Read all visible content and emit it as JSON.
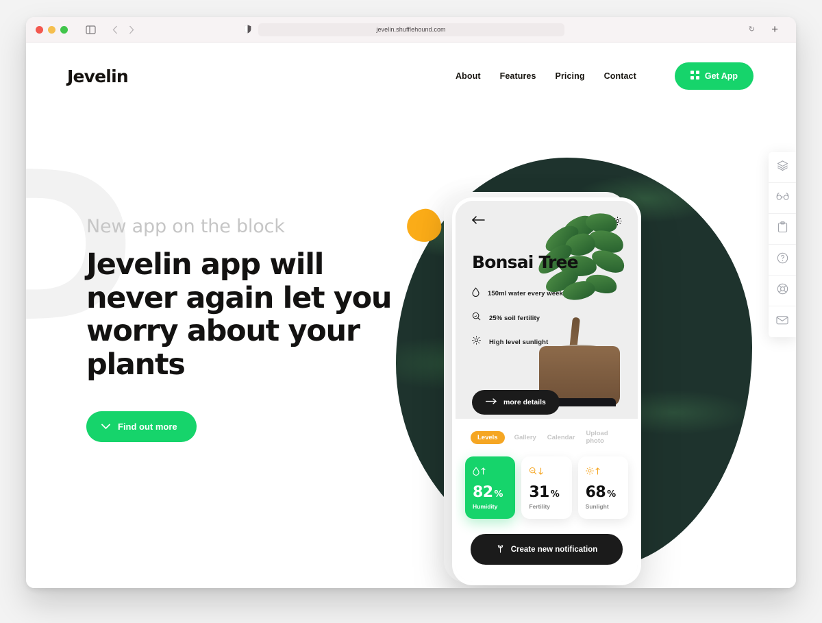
{
  "browser": {
    "url": "jevelin.shufflehound.com",
    "sidebar_icon": "sidebar-icon",
    "back_icon": "chevron-left-icon",
    "forward_icon": "chevron-right-icon",
    "shield_icon": "shield-icon",
    "reload_icon": "reload-icon",
    "newtab_icon": "plus-icon"
  },
  "header": {
    "logo": "Jevelin",
    "nav": [
      {
        "label": "About"
      },
      {
        "label": "Features"
      },
      {
        "label": "Pricing"
      },
      {
        "label": "Contact"
      }
    ],
    "cta": {
      "label": "Get App",
      "icon": "grid-icon",
      "color": "#16d46b"
    }
  },
  "hero": {
    "eyebrow": "New app on the block",
    "heading": "Jevelin app will never again let you worry about your plants",
    "button": {
      "label": "Find out more",
      "icon": "chevron-down-icon",
      "color": "#16d46b"
    },
    "ghost_letter": "D"
  },
  "phone": {
    "back_icon": "arrow-left-icon",
    "settings_icon": "gear-icon",
    "plant_title": "Bonsai Tree",
    "specs": [
      {
        "icon": "water-drop-icon",
        "text": "150ml water every week"
      },
      {
        "icon": "soil-fertility-icon",
        "text": "25% soil fertility"
      },
      {
        "icon": "sun-icon",
        "text": "High level sunlight"
      }
    ],
    "more_button": {
      "label": "more details",
      "icon": "arrow-right-icon"
    },
    "tabs": [
      {
        "label": "Levels",
        "active": true
      },
      {
        "label": "Gallery",
        "active": false
      },
      {
        "label": "Calendar",
        "active": false
      },
      {
        "label": "Upload photo",
        "active": false
      }
    ],
    "tab_active_color": "#f5a623",
    "stats": [
      {
        "value": "82",
        "unit": "%",
        "label": "Humidity",
        "icon": "water-drop-icon",
        "trend": "up",
        "highlight": true
      },
      {
        "value": "31",
        "unit": "%",
        "label": "Fertility",
        "icon": "soil-fertility-icon",
        "trend": "down",
        "highlight": false
      },
      {
        "value": "68",
        "unit": "%",
        "label": "Sunlight",
        "icon": "sun-icon",
        "trend": "up",
        "highlight": false
      }
    ],
    "notify_button": {
      "label": "Create new notification",
      "icon": "sprout-icon"
    }
  },
  "rail": [
    {
      "icon": "layers-icon"
    },
    {
      "icon": "glasses-icon"
    },
    {
      "icon": "clipboard-icon"
    },
    {
      "icon": "question-circle-icon"
    },
    {
      "icon": "lifebuoy-icon"
    },
    {
      "icon": "envelope-icon"
    }
  ]
}
